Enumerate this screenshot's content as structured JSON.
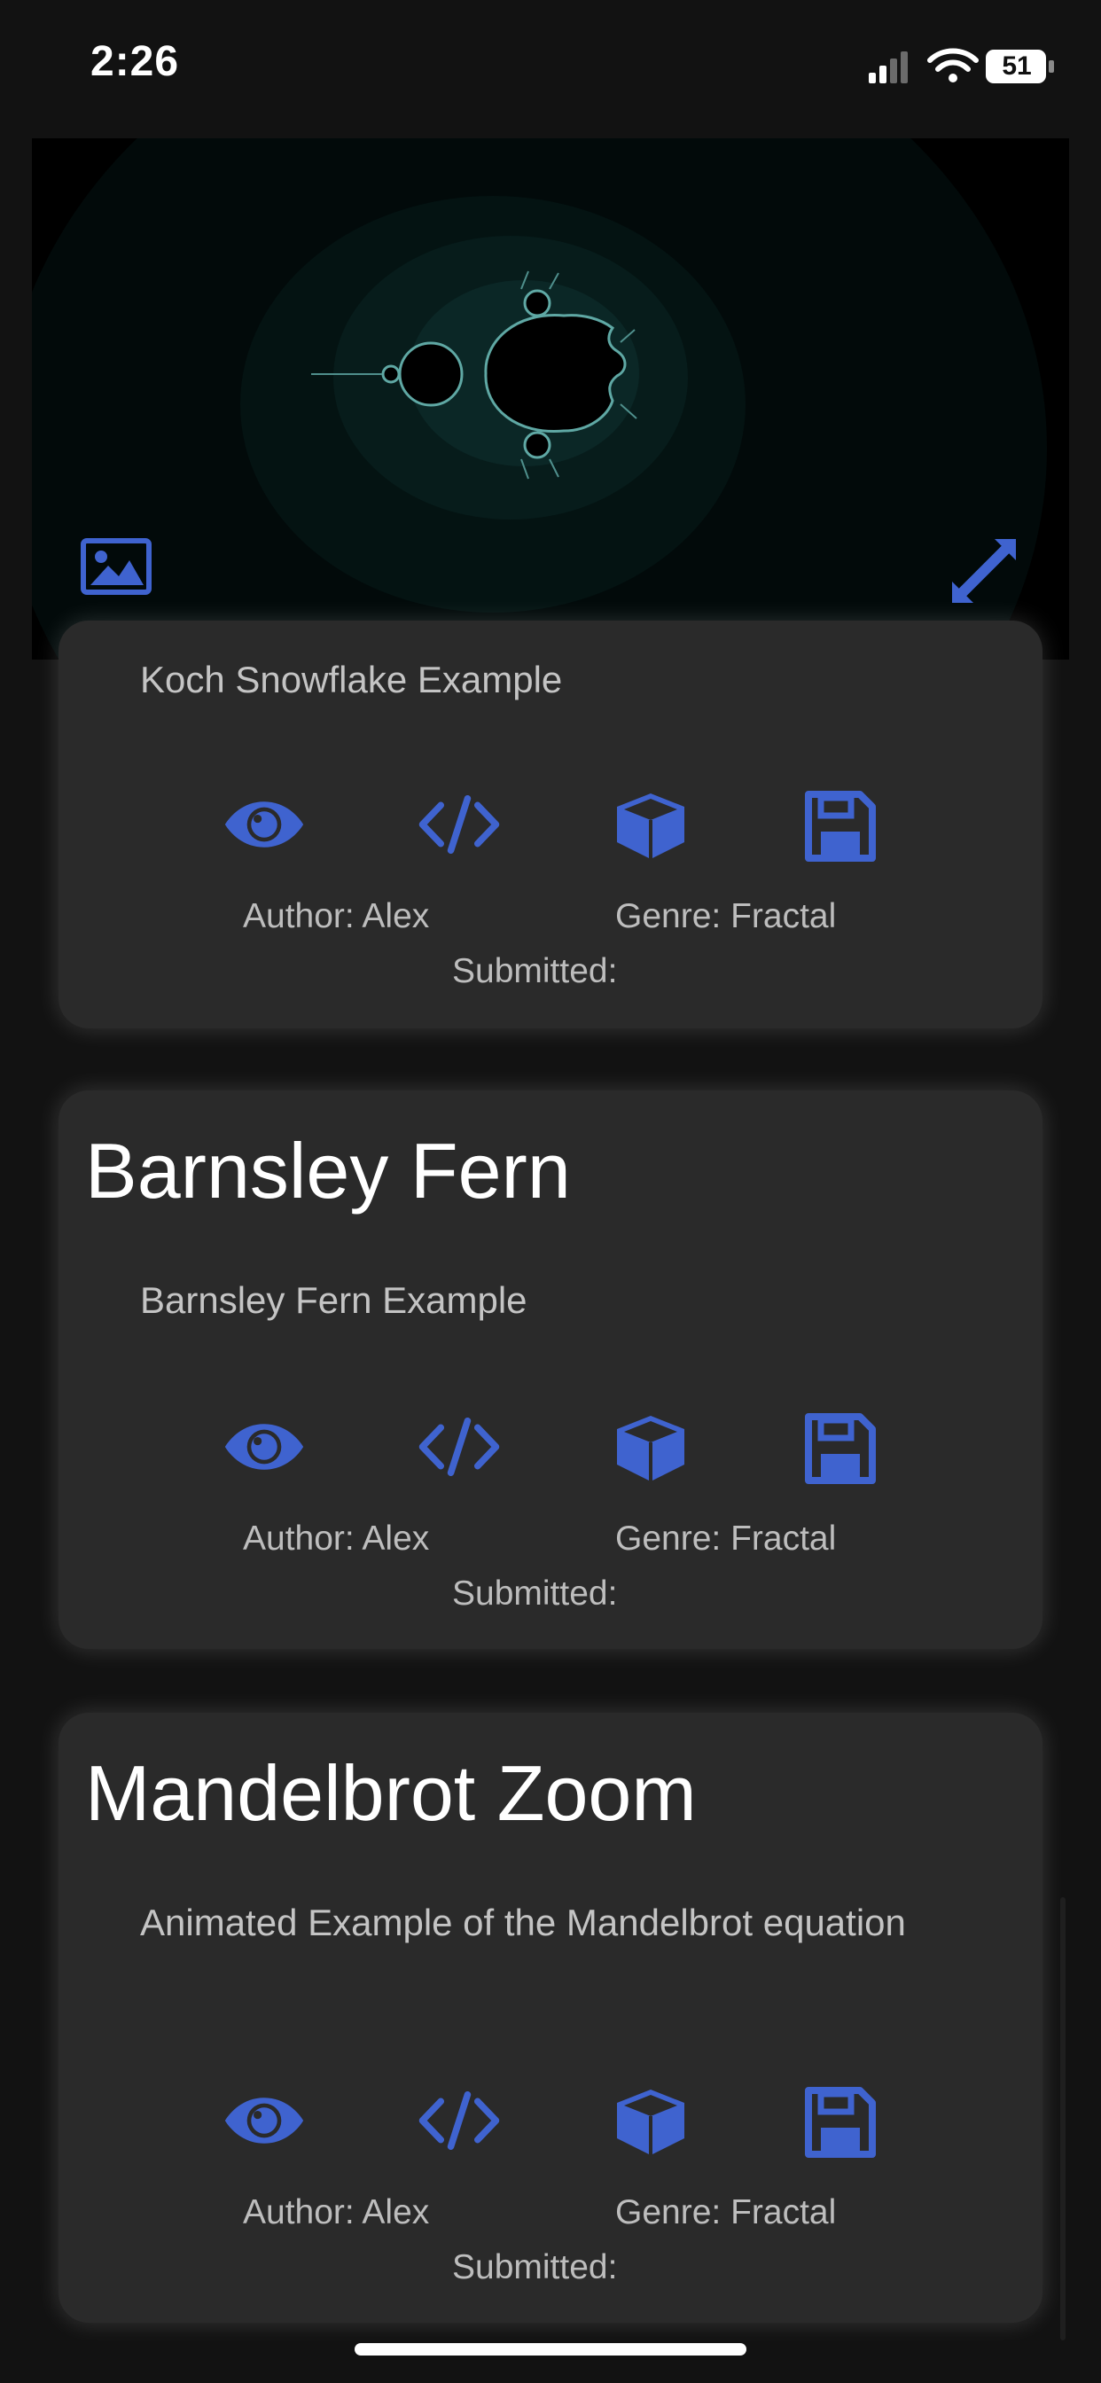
{
  "status_bar": {
    "time": "2:26",
    "battery": "51"
  },
  "preview": {
    "icons": {
      "image": "image-icon",
      "expand": "expand-icon"
    }
  },
  "cards": [
    {
      "title": "",
      "description": "Koch Snowflake Example",
      "author": "Author: Alex",
      "genre": "Genre: Fractal",
      "submitted": "Submitted:"
    },
    {
      "title": "Barnsley Fern",
      "description": "Barnsley Fern Example",
      "author": "Author: Alex",
      "genre": "Genre: Fractal",
      "submitted": "Submitted:"
    },
    {
      "title": "Mandelbrot Zoom",
      "description": "Animated Example of the Mandelbrot equation",
      "author": "Author: Alex",
      "genre": "Genre: Fractal",
      "submitted": "Submitted:"
    }
  ],
  "actions": [
    "view-icon",
    "code-icon",
    "cube-icon",
    "save-icon"
  ],
  "colors": {
    "accent": "#3f63cf",
    "card_bg": "#2a2a2a",
    "page_bg": "#121212"
  }
}
